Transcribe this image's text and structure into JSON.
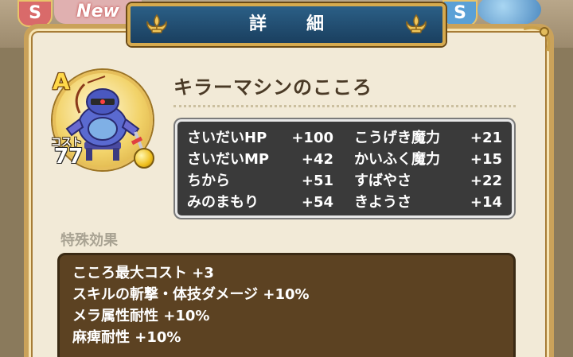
{
  "background": {
    "badge_left": "S",
    "badge_new": "New",
    "badge_right": "S"
  },
  "header": {
    "title": "詳　細"
  },
  "monster": {
    "rank": "A",
    "cost_label": "コスト",
    "cost_value": "77",
    "name": "キラーマシンのこころ",
    "icon": "killer-machine-portrait-icon"
  },
  "stats": {
    "rows": [
      {
        "left_name": "さいだいHP",
        "left_value": "+100",
        "right_name": "こうげき魔力",
        "right_value": "+21"
      },
      {
        "left_name": "さいだいMP",
        "left_value": "+42",
        "right_name": "かいふく魔力",
        "right_value": "+15"
      },
      {
        "left_name": "ちから",
        "left_value": "+51",
        "right_name": "すばやさ",
        "right_value": "+22"
      },
      {
        "left_name": "みのまもり",
        "left_value": "+54",
        "right_name": "きようさ",
        "right_value": "+14"
      }
    ]
  },
  "special_effects": {
    "label": "特殊効果",
    "items": [
      "こころ最大コスト +3",
      "スキルの斬撃・体技ダメージ +10%",
      "メラ属性耐性 +10%",
      "麻痺耐性 +10%"
    ]
  },
  "colors": {
    "banner": "#1a3f5f",
    "gold": "#d6aa4e",
    "panel": "#f2ead7",
    "stats_bg": "#3a3a3a",
    "effects_bg": "#5c4222"
  }
}
